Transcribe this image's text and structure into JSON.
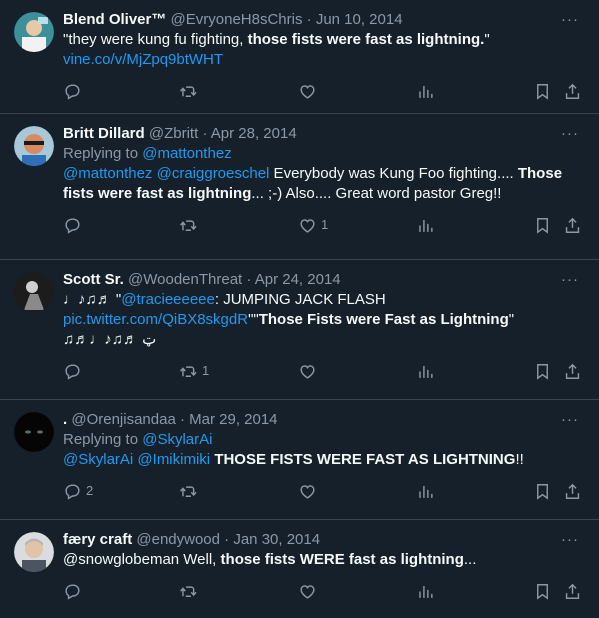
{
  "more_label": "···",
  "tweets": [
    {
      "name": "Blend Oliver™",
      "handle": "@EvryoneH8sChris",
      "date": "Jun 10, 2014",
      "text_a": "\"they were kung fu fighting, ",
      "text_b": "those fists were fast as lightning.",
      "text_c": "\"",
      "link": "vine.co/v/MjZpq9btWHT"
    },
    {
      "name": "Britt Dillard",
      "handle": "@Zbritt",
      "date": "Apr 28, 2014",
      "replying_prefix": "Replying to ",
      "replying_to": "@mattonthez",
      "mention_1": "@mattonthez",
      "mention_2": "@craiggroeschel",
      "text_a": " Everybody was Kung Foo fighting.... ",
      "text_b": "Those fists were fast as lightning",
      "text_c": "... ;-) Also.... Great word pastor Greg!!",
      "like_count": "1"
    },
    {
      "name": "Scott Sr.",
      "handle": "@WoodenThreat",
      "date": "Apr 24, 2014",
      "text_a": "♩♪♫♬ \"",
      "mention_1": "@tracieeeeee",
      "text_b": ": JUMPING JACK FLASH",
      "link": "pic.twitter.com/QiBX8skgdR",
      "text_c": "\"\"",
      "text_d": "Those Fists were Fast as Lightning",
      "text_e": "\"",
      "text_f": "♫♬♩♪♫♬ ټ",
      "retweet_count": "1"
    },
    {
      "name": ".",
      "handle": "@Orenjisandaa",
      "date": "Mar 29, 2014",
      "replying_prefix": "Replying to ",
      "replying_to": "@SkylarAi",
      "mention_1": "@SkylarAi",
      "mention_2": "@Imikimiki",
      "text_a": " ",
      "text_b": "THOSE FISTS WERE FAST AS LIGHTNING",
      "text_c": "!!",
      "reply_count": "2"
    },
    {
      "name": "færy craft",
      "handle": "@endywood",
      "date": "Jan 30, 2014",
      "text_a": "@snowglobeman Well, ",
      "text_b": "those fists WERE fast as lightning",
      "text_c": "..."
    }
  ]
}
